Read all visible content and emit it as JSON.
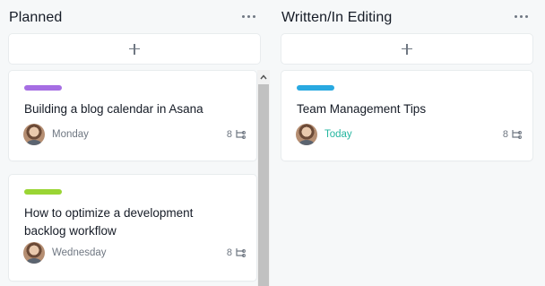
{
  "columns": [
    {
      "title": "Planned",
      "more_icon": "ellipsis-icon",
      "add_icon": "plus-icon",
      "cards": [
        {
          "tag_color": "#a66ee3",
          "title": "Building a blog calendar in Asana",
          "due": "Monday",
          "subtasks": "8",
          "subtask_icon": "subtask-icon"
        },
        {
          "tag_color": "#9ad534",
          "title": "How to optimize a development backlog workflow",
          "due": "Wednesday",
          "subtasks": "8",
          "subtask_icon": "subtask-icon"
        }
      ]
    },
    {
      "title": "Written/In Editing",
      "more_icon": "ellipsis-icon",
      "add_icon": "plus-icon",
      "cards": [
        {
          "tag_color": "#29a9e1",
          "title": "Team Management Tips",
          "due": "Today",
          "due_color": "#25b6a0",
          "subtasks": "8",
          "subtask_icon": "subtask-icon"
        }
      ]
    }
  ]
}
